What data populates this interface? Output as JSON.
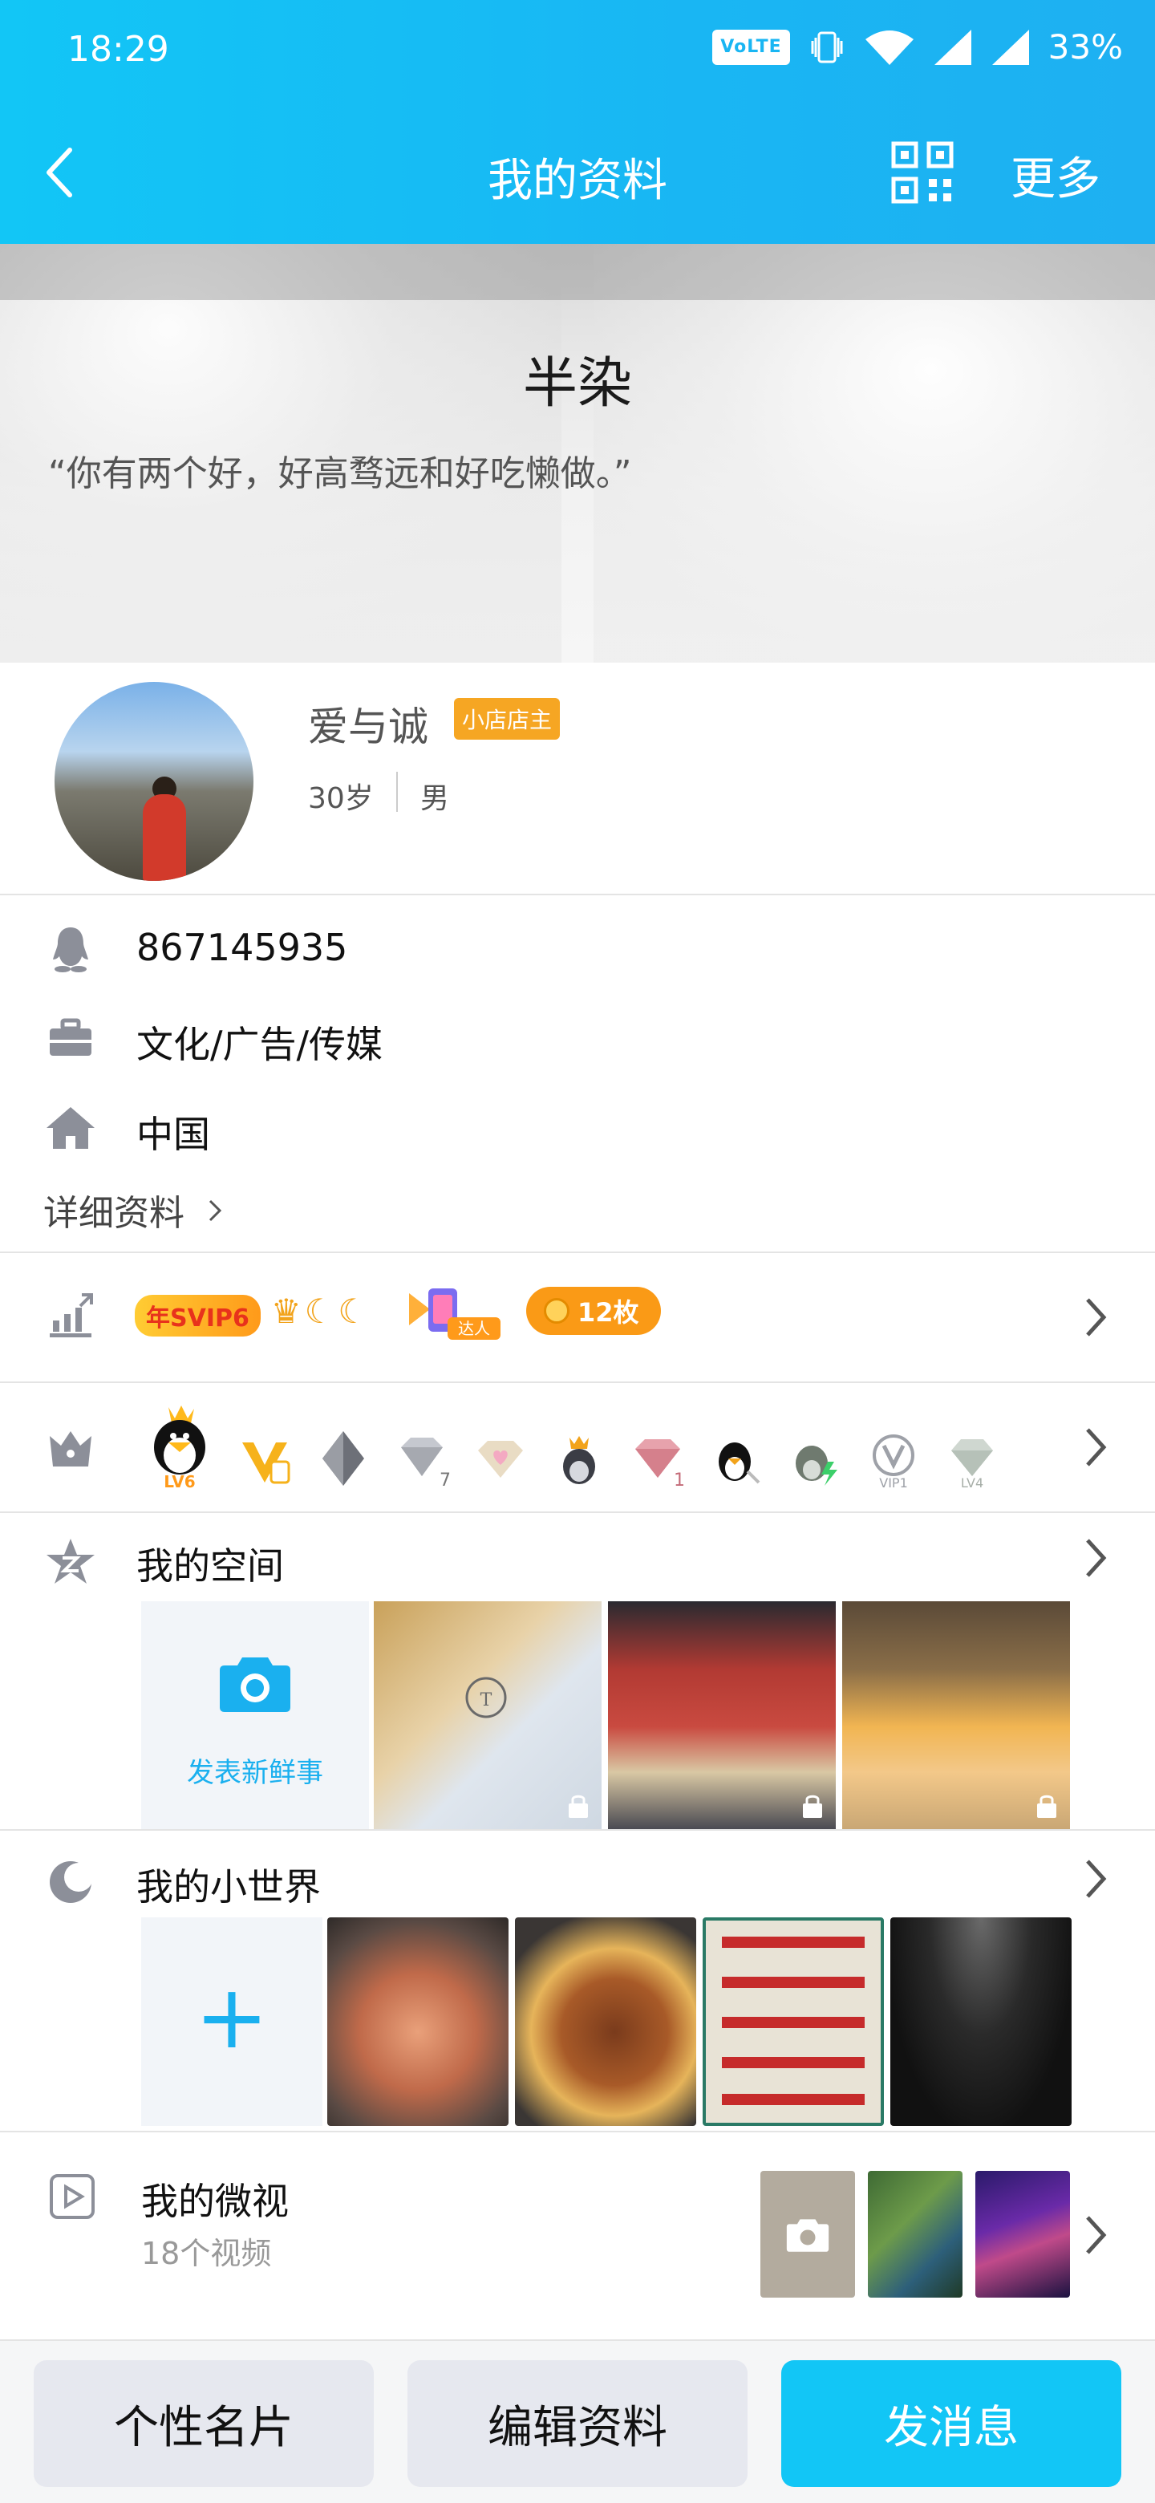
{
  "status": {
    "time": "18:29",
    "volte": "VoLTE",
    "battery": "33%"
  },
  "nav": {
    "title": "我的资料",
    "more": "更多"
  },
  "cover": {
    "nickname": "半染",
    "signature": "“你有两个好，好高骛远和好吃懒做。”"
  },
  "profile": {
    "name": "爱与诚",
    "badge": "小店店主",
    "age": "30岁",
    "gender": "男"
  },
  "info": {
    "qq": "867145935",
    "job": "文化/广告/传媒",
    "location": "中国",
    "detail_link": "详细资料"
  },
  "badges": {
    "svip": "年SVIP6",
    "medal_count": "12枚",
    "daren": "达人"
  },
  "vip_icons": [
    "qq-lv6-icon",
    "vip-v-icon",
    "diamond-icon",
    "diamond-7-icon",
    "heart-diamond-icon",
    "penguin-crown-icon",
    "diamond-1-icon",
    "penguin-icon",
    "green-penguin-icon",
    "vip1-icon",
    "diamond-lv4-icon"
  ],
  "vip_labels": {
    "lv": "LV6",
    "vip1": "VIP1",
    "lv4": "LV4"
  },
  "space": {
    "title": "我的空间",
    "post_label": "发表新鲜事"
  },
  "world": {
    "title": "我的小世界",
    "add": "+"
  },
  "weishi": {
    "title": "我的微视",
    "count": "18个视频"
  },
  "bottom": {
    "card": "个性名片",
    "edit": "编辑资料",
    "message": "发消息"
  },
  "colors": {
    "brand": "#12c6f6",
    "accent_orange": "#f6a623",
    "text_gray": "#999999"
  }
}
